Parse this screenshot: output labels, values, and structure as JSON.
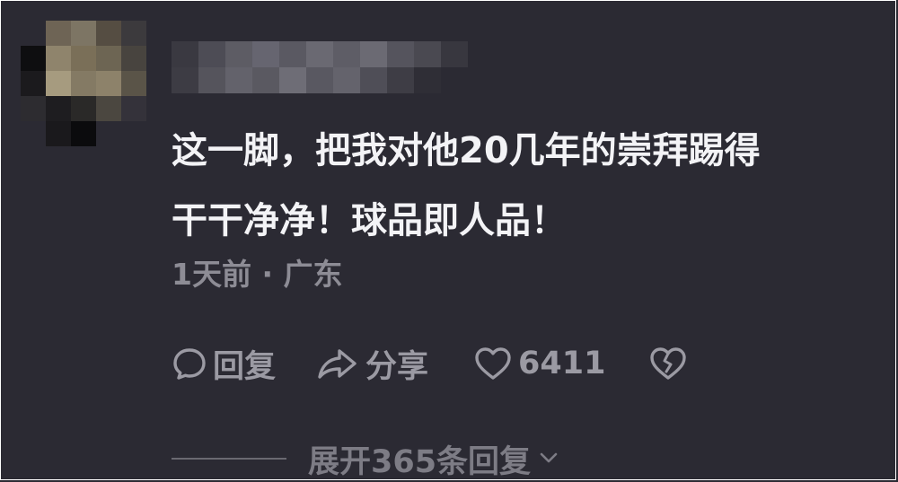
{
  "comment": {
    "line1": "这一脚，把我对他20几年的崇拜踢得",
    "line2": "干干净净！球品即人品！"
  },
  "meta": {
    "time": "1天前",
    "separator": " · ",
    "location": "广东"
  },
  "actions": {
    "reply_label": "回复",
    "share_label": "分享",
    "like_count": "6411"
  },
  "replies": {
    "expand_label": "展开365条回复"
  },
  "icons": {
    "reply": "speech-bubble-icon",
    "share": "share-arrow-icon",
    "like": "heart-icon",
    "dislike": "broken-heart-icon",
    "expand": "chevron-down-icon"
  },
  "colors": {
    "background": "#2b2a33",
    "text": "#f3f3f6",
    "muted": "#9b9aa3"
  }
}
